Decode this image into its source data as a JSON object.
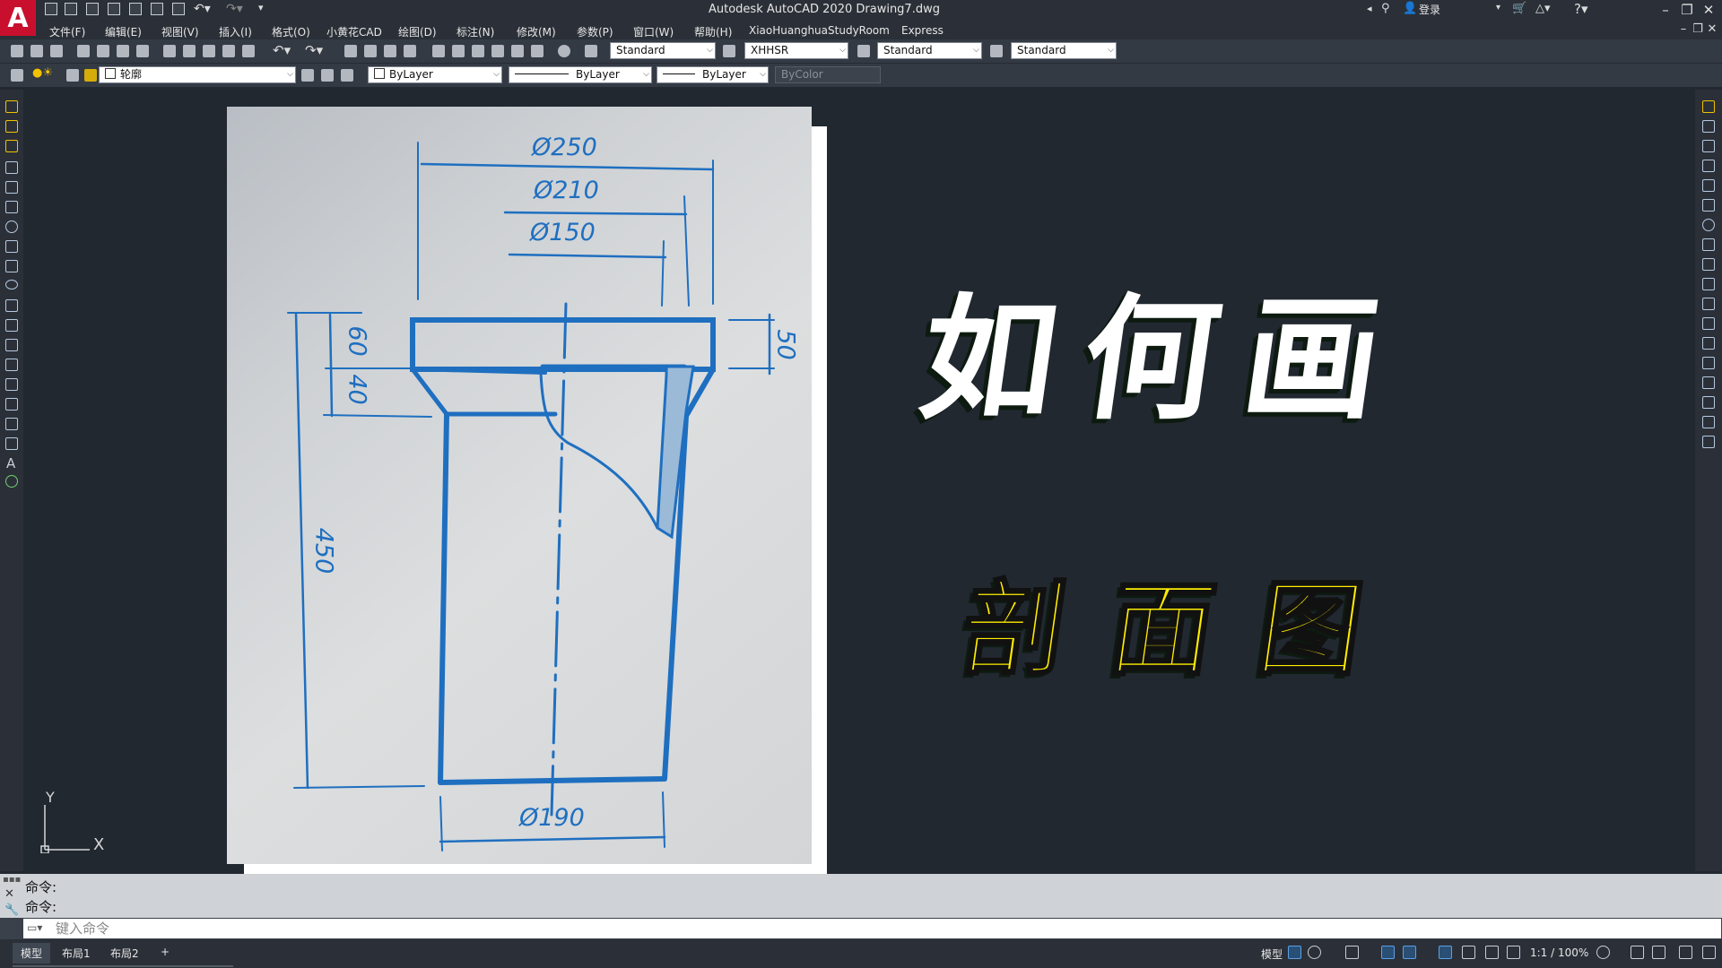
{
  "app": {
    "logo": "A",
    "title": "Autodesk AutoCAD 2020    Drawing7.dwg",
    "login": "登录",
    "colors": {
      "logo_red": "#c8102e",
      "highlight_yellow": "#ffee00",
      "blueprint_blue": "#1f6fc0"
    }
  },
  "menu": {
    "items": [
      "文件(F)",
      "编辑(E)",
      "视图(V)",
      "插入(I)",
      "格式(O)",
      "小黄花CAD",
      "绘图(D)",
      "标注(N)",
      "修改(M)",
      "参数(P)",
      "窗口(W)",
      "帮助(H)",
      "XiaoHuanghuaStudyRoom",
      "Express"
    ]
  },
  "toolbar": {
    "text_style": "Standard",
    "dim_style": "XHHSR",
    "table_style": "Standard",
    "multileader_style": "Standard",
    "layer": "轮廓",
    "color": "ByLayer",
    "linetype": "ByLayer",
    "lineweight": "ByLayer",
    "plotstyle": "ByColor"
  },
  "drawing": {
    "dimensions": {
      "d250": "Ø250",
      "d210": "Ø210",
      "d150": "Ø150",
      "h60": "60",
      "h40": "40",
      "h50": "50",
      "h450": "450",
      "d190": "Ø190"
    },
    "overlay_title": "如何画",
    "overlay_subtitle": "剖面图",
    "ucs_x": "X",
    "ucs_y": "Y"
  },
  "command": {
    "history": [
      "命令:",
      "命令:"
    ],
    "placeholder": "键入命令"
  },
  "status": {
    "tabs": [
      "模型",
      "布局1",
      "布局2"
    ],
    "add_tab": "+",
    "model_label": "模型",
    "scale": "1:1 / 100%"
  }
}
